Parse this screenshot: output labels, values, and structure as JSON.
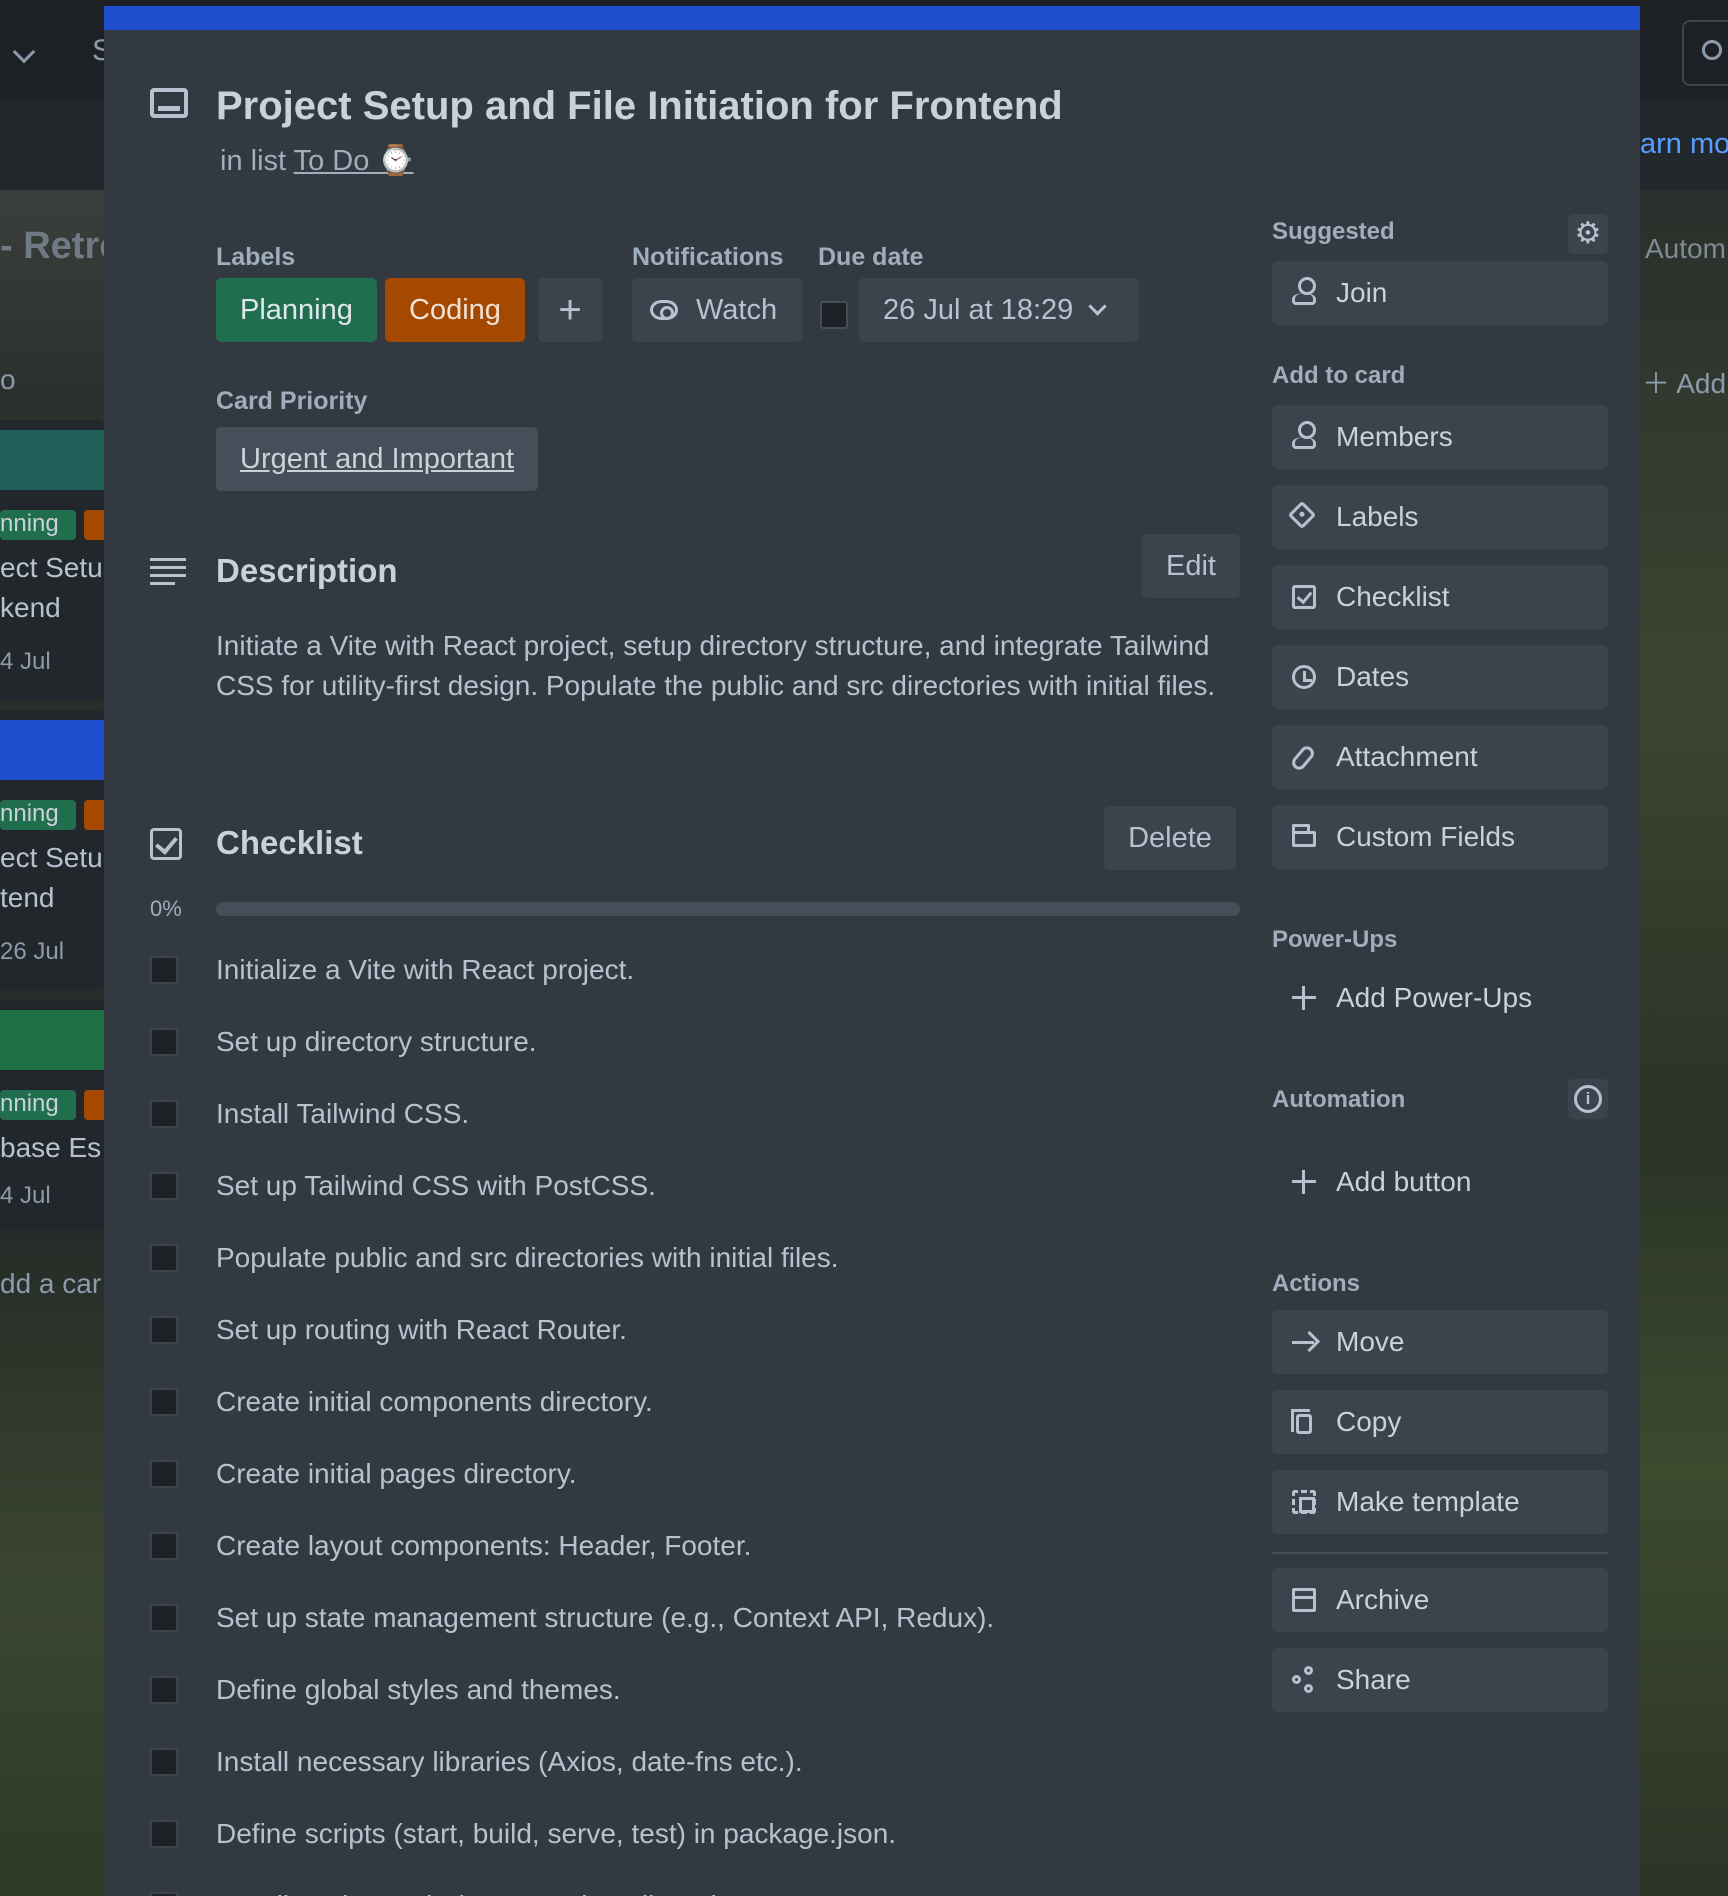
{
  "background": {
    "board_title_fragment": "- Retro",
    "list_title_fragment": "o",
    "automation_fragment": "Autom",
    "learn_more_fragment": "arn mo",
    "add_list_fragment": "Add",
    "nav_fragment": "S",
    "cards": [
      {
        "tag": "nning",
        "title_line1": "ect Setu",
        "title_line2": "kend",
        "date": "4 Jul",
        "cover_color": "#1f5f5a"
      },
      {
        "tag": "nning",
        "title_line1": "ect Setu",
        "title_line2": "tend",
        "date": "26 Jul",
        "cover_color": "#1f4fcf"
      },
      {
        "tag": "nning",
        "title_line1": "base Es",
        "title_line2": "",
        "date": "4 Jul",
        "cover_color": "#1f6f45"
      }
    ],
    "add_card_fragment": "dd a car"
  },
  "card": {
    "title": "Project Setup and File Initiation for Frontend",
    "in_list_prefix": "in list",
    "list_name": "To Do ⌚"
  },
  "labels_section": {
    "label": "Labels",
    "labels": [
      {
        "name": "Planning",
        "color": "#216e4e"
      },
      {
        "name": "Coding",
        "color": "#a54800"
      }
    ],
    "add_label": "+"
  },
  "notifications": {
    "label": "Notifications",
    "watch": "Watch"
  },
  "due_date": {
    "label": "Due date",
    "value": "26 Jul at 18:29",
    "completed": false
  },
  "card_priority": {
    "label": "Card Priority",
    "value": "Urgent and Important"
  },
  "description": {
    "heading": "Description",
    "edit": "Edit",
    "text": "Initiate a Vite with React project, setup directory structure, and integrate Tailwind CSS for utility-first design. Populate the public and src directories with initial files."
  },
  "checklist": {
    "heading": "Checklist",
    "delete": "Delete",
    "progress_label": "0%",
    "progress": 0,
    "items": [
      {
        "text": "Initialize a Vite with React project.",
        "checked": false
      },
      {
        "text": "Set up directory structure.",
        "checked": false
      },
      {
        "text": "Install Tailwind CSS.",
        "checked": false
      },
      {
        "text": "Set up Tailwind CSS with PostCSS.",
        "checked": false
      },
      {
        "text": "Populate public and src directories with initial files.",
        "checked": false
      },
      {
        "text": "Set up routing with React Router.",
        "checked": false
      },
      {
        "text": "Create initial components directory.",
        "checked": false
      },
      {
        "text": "Create initial pages directory.",
        "checked": false
      },
      {
        "text": "Create layout components: Header, Footer.",
        "checked": false
      },
      {
        "text": "Set up state management structure (e.g., Context API, Redux).",
        "checked": false
      },
      {
        "text": "Define global styles and themes.",
        "checked": false
      },
      {
        "text": "Install necessary libraries (Axios, date-fns etc.).",
        "checked": false
      },
      {
        "text": "Define scripts (start, build, serve, test) in package.json.",
        "checked": false
      },
      {
        "text": "Install testing tools (Jest, Testing Library).",
        "checked": false
      }
    ]
  },
  "sidebar": {
    "suggested": "Suggested",
    "join": "Join",
    "add_to_card": "Add to card",
    "add_items": [
      "Members",
      "Labels",
      "Checklist",
      "Dates",
      "Attachment",
      "Custom Fields"
    ],
    "power_ups": "Power-Ups",
    "add_power_ups": "Add Power-Ups",
    "automation": "Automation",
    "add_button": "Add button",
    "actions": "Actions",
    "action_items": [
      "Move",
      "Copy",
      "Make template",
      "Archive",
      "Share"
    ]
  }
}
